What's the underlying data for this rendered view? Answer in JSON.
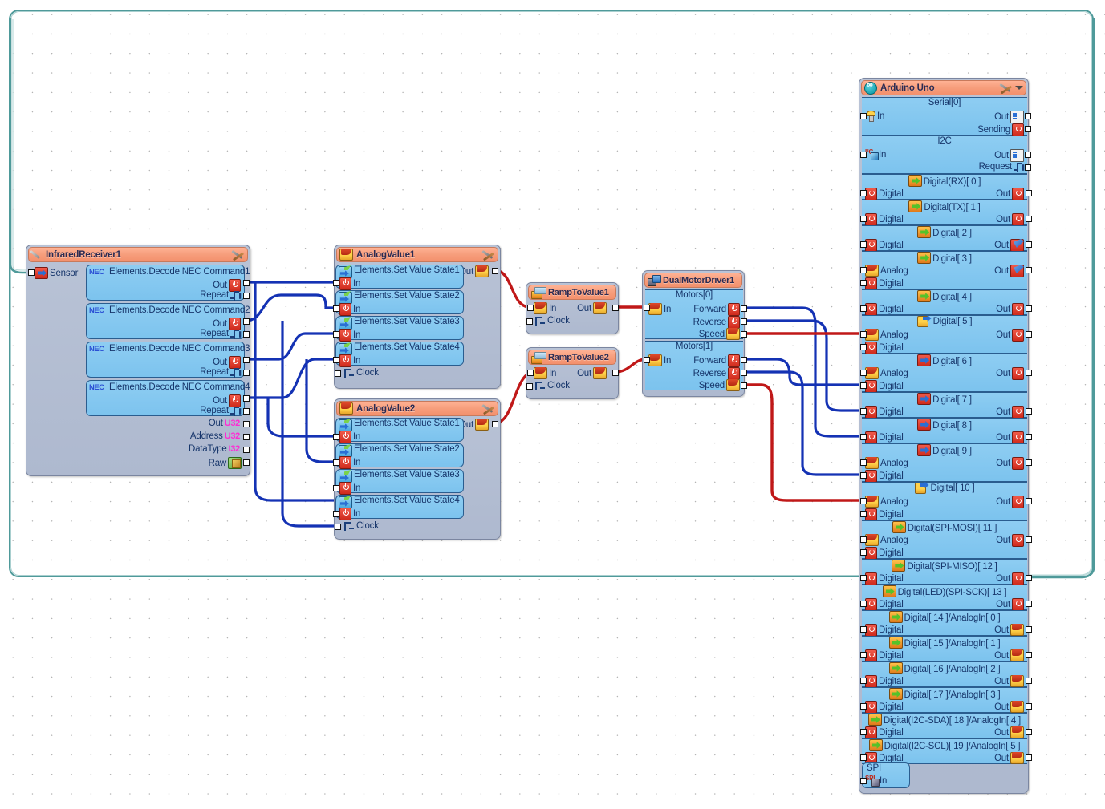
{
  "app": {
    "canvas_label": "visuino-flow-canvas"
  },
  "blocks": {
    "infrared": {
      "title": "InfraredReceiver1",
      "icon": "wand-icon",
      "tools_icon": "tools-icon",
      "sensor_port": "Sensor",
      "commands": [
        {
          "title": "Elements.Decode NEC Command1",
          "badge": "NEC",
          "out": "Out",
          "repeat": "Repeat"
        },
        {
          "title": "Elements.Decode NEC Command2",
          "badge": "NEC",
          "out": "Out",
          "repeat": "Repeat"
        },
        {
          "title": "Elements.Decode NEC Command3",
          "badge": "NEC",
          "out": "Out",
          "repeat": "Repeat"
        },
        {
          "title": "Elements.Decode NEC Command4",
          "badge": "NEC",
          "out": "Out",
          "repeat": "Repeat"
        }
      ],
      "footer_ports": [
        {
          "label": "Out",
          "type": "U32"
        },
        {
          "label": "Address",
          "type": "U32"
        },
        {
          "label": "DataType",
          "type": "I32"
        },
        {
          "label": "Raw",
          "type": ""
        }
      ]
    },
    "analog1": {
      "title": "AnalogValue1",
      "out_label": "Out",
      "clock_label": "Clock",
      "states": [
        {
          "title": "Elements.Set Value State1",
          "in": "In"
        },
        {
          "title": "Elements.Set Value State2",
          "in": "In"
        },
        {
          "title": "Elements.Set Value State3",
          "in": "In"
        },
        {
          "title": "Elements.Set Value State4",
          "in": "In"
        }
      ]
    },
    "analog2": {
      "title": "AnalogValue2",
      "out_label": "Out",
      "clock_label": "Clock",
      "states": [
        {
          "title": "Elements.Set Value State1",
          "in": "In"
        },
        {
          "title": "Elements.Set Value State2",
          "in": "In"
        },
        {
          "title": "Elements.Set Value State3",
          "in": "In"
        },
        {
          "title": "Elements.Set Value State4",
          "in": "In"
        }
      ]
    },
    "ramp1": {
      "title": "RampToValue1",
      "in": "In",
      "out": "Out",
      "clock": "Clock"
    },
    "ramp2": {
      "title": "RampToValue2",
      "in": "In",
      "out": "Out",
      "clock": "Clock"
    },
    "motor": {
      "title": "DualMotorDriver1",
      "motors": [
        {
          "name": "Motors[0]",
          "in": "In",
          "forward": "Forward",
          "reverse": "Reverse",
          "speed": "Speed"
        },
        {
          "name": "Motors[1]",
          "in": "In",
          "forward": "Forward",
          "reverse": "Reverse",
          "speed": "Speed"
        }
      ]
    },
    "arduino": {
      "title": "Arduino Uno",
      "icon": "arduino-logo-icon",
      "serial": {
        "name": "Serial[0]",
        "in": "In",
        "out": "Out",
        "sending": "Sending"
      },
      "i2c": {
        "name": "I2C",
        "in": "In",
        "out": "Out",
        "request": "Request"
      },
      "pins": [
        {
          "name": "Digital(RX)[ 0 ]",
          "inputs": [
            "Digital"
          ],
          "out": "Out",
          "head_icon": "green-arrow-icon",
          "out_icon": "power-icon"
        },
        {
          "name": "Digital(TX)[ 1 ]",
          "inputs": [
            "Digital"
          ],
          "out": "Out",
          "head_icon": "green-arrow-icon",
          "out_icon": "power-icon"
        },
        {
          "name": "Digital[ 2 ]",
          "inputs": [
            "Digital"
          ],
          "out": "Out",
          "head_icon": "green-arrow-icon",
          "out_icon": "doc-icon"
        },
        {
          "name": "Digital[ 3 ]",
          "inputs": [
            "Analog",
            "Digital"
          ],
          "out": "Out",
          "head_icon": "green-arrow-icon",
          "out_icon": "doc-icon"
        },
        {
          "name": "Digital[ 4 ]",
          "inputs": [
            "Digital"
          ],
          "out": "Out",
          "head_icon": "green-arrow-icon",
          "out_icon": "power-icon"
        },
        {
          "name": "Digital[ 5 ]",
          "inputs": [
            "Analog",
            "Digital"
          ],
          "out": "Out",
          "head_icon": "analog-arrow-icon",
          "out_icon": "power-icon"
        },
        {
          "name": "Digital[ 6 ]",
          "inputs": [
            "Analog",
            "Digital"
          ],
          "out": "Out",
          "head_icon": "red-arrow-icon",
          "out_icon": "power-icon"
        },
        {
          "name": "Digital[ 7 ]",
          "inputs": [
            "Digital"
          ],
          "out": "Out",
          "head_icon": "red-arrow-icon",
          "out_icon": "power-icon"
        },
        {
          "name": "Digital[ 8 ]",
          "inputs": [
            "Digital"
          ],
          "out": "Out",
          "head_icon": "red-arrow-icon",
          "out_icon": "power-icon"
        },
        {
          "name": "Digital[ 9 ]",
          "inputs": [
            "Analog",
            "Digital"
          ],
          "out": "Out",
          "head_icon": "red-arrow-icon",
          "out_icon": "power-icon"
        },
        {
          "name": "Digital[ 10 ]",
          "inputs": [
            "Analog",
            "Digital"
          ],
          "out": "Out",
          "head_icon": "analog-arrow-icon",
          "out_icon": "power-icon"
        },
        {
          "name": "Digital(SPI-MOSI)[ 11 ]",
          "inputs": [
            "Analog",
            "Digital"
          ],
          "out": "Out",
          "head_icon": "green-arrow-icon",
          "out_icon": "power-icon"
        },
        {
          "name": "Digital(SPI-MISO)[ 12 ]",
          "inputs": [
            "Digital"
          ],
          "out": "Out",
          "head_icon": "green-arrow-icon",
          "out_icon": "power-icon"
        },
        {
          "name": "Digital(LED)(SPI-SCK)[ 13 ]",
          "inputs": [
            "Digital"
          ],
          "out": "Out",
          "head_icon": "green-arrow-icon",
          "out_icon": "power-icon"
        },
        {
          "name": "Digital[ 14 ]/AnalogIn[ 0 ]",
          "inputs": [
            "Digital"
          ],
          "out": "Out",
          "head_icon": "green-analog-icon",
          "out_icon": "analog-icon"
        },
        {
          "name": "Digital[ 15 ]/AnalogIn[ 1 ]",
          "inputs": [
            "Digital"
          ],
          "out": "Out",
          "head_icon": "green-analog-icon",
          "out_icon": "analog-icon"
        },
        {
          "name": "Digital[ 16 ]/AnalogIn[ 2 ]",
          "inputs": [
            "Digital"
          ],
          "out": "Out",
          "head_icon": "green-analog-icon",
          "out_icon": "analog-icon"
        },
        {
          "name": "Digital[ 17 ]/AnalogIn[ 3 ]",
          "inputs": [
            "Digital"
          ],
          "out": "Out",
          "head_icon": "green-analog-icon",
          "out_icon": "analog-icon"
        },
        {
          "name": "Digital(I2C-SDA)[ 18 ]/AnalogIn[ 4 ]",
          "inputs": [
            "Digital"
          ],
          "out": "Out",
          "head_icon": "green-analog-icon",
          "out_icon": "analog-icon"
        },
        {
          "name": "Digital(I2C-SCL)[ 19 ]/AnalogIn[ 5 ]",
          "inputs": [
            "Digital"
          ],
          "out": "Out",
          "head_icon": "green-analog-icon",
          "out_icon": "analog-icon"
        }
      ],
      "spi": {
        "name": "SPI",
        "in": "In"
      }
    }
  },
  "colors": {
    "wire_blue": "#1432b4",
    "wire_red": "#c01818",
    "wire_teal": "#4f9a9a",
    "header_orange": "#f79f7e",
    "sub_blue": "#7cc3ee",
    "block_grey": "#aeb9cf"
  }
}
